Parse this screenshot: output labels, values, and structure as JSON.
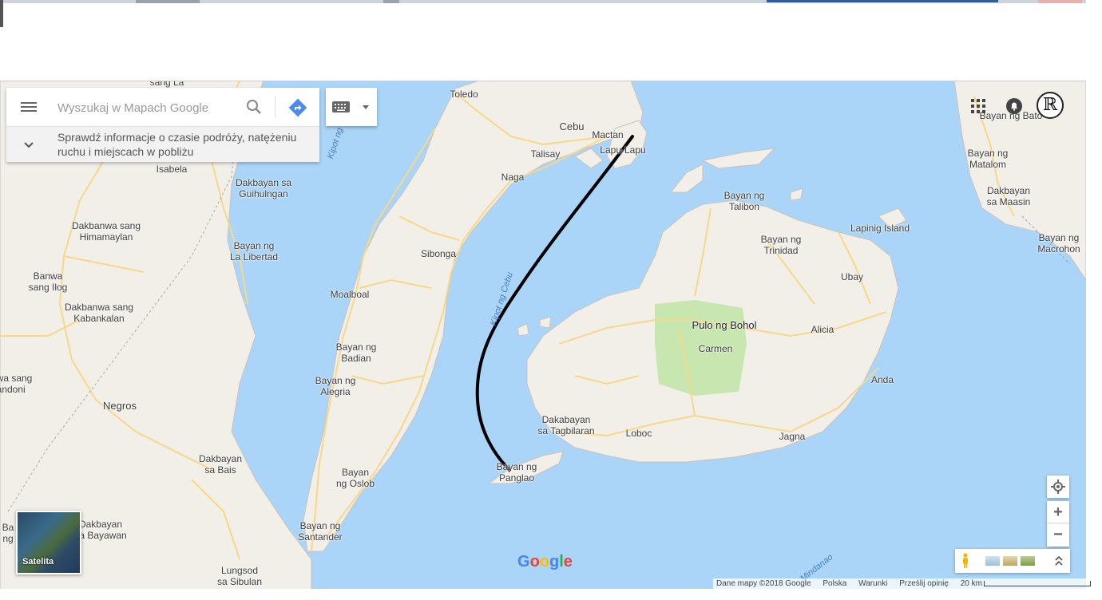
{
  "search": {
    "placeholder": "Wyszukaj w Mapach Google",
    "info_text": "Sprawdź informacje o czasie podróży, natężeniu ruchu i miejscach w pobliżu"
  },
  "places": {
    "toledo": "Toledo",
    "cebu": "Cebu",
    "mactan": "Mactan",
    "lapulapu": "Lapu-Lapu",
    "talisay": "Talisay",
    "naga": "Naga",
    "sibonga": "Sibonga",
    "moalboal": "Moalboal",
    "badian": "Bayan ng\nBadian",
    "alegria": "Bayan ng\nAlegria",
    "oslob": "Bayan\nng Oslob",
    "santander": "Bayan ng\nSantander",
    "isabela": "Isabela",
    "guihulngan": "Dakbayan sa\nGuihulngan",
    "himamaylan": "Dakbanwa sang\nHimamaylan",
    "lalibertad": "Bayan ng\nLa Libertad",
    "ilog": "Banwa\nsang Ilog",
    "kabankalan": "Dakbanwa sang\nKabankalan",
    "negros": "Negros",
    "bais": "Dakbayan\nsa Bais",
    "bayawan": "Dakbayan\nsa Bayawan",
    "sibulan": "Lungsod\nsa Sibulan",
    "candoni": "wa sang\nandoni",
    "sangla": "sang La",
    "talibon": "Bayan ng\nTalibon",
    "trinidad": "Bayan ng\nTrinidad",
    "lapinig": "Lapinig Island",
    "ubay": "Ubay",
    "bohol": "Pulo ng Bohol",
    "carmen": "Carmen",
    "alicia": "Alicia",
    "anda": "Anda",
    "tagbilaran": "Dakabayan\nsa Tagbilaran",
    "loboc": "Loboc",
    "jagna": "Jagna",
    "panglao": "Bayan ng\nPanglao",
    "bato": "Bayan ng Bato",
    "matalom": "Bayan ng\nMatalom",
    "maasin": "Dakbayan\nsa Maasin",
    "macrohon": "Bayan ng\nMacrohon",
    "ba": "Ba\nng"
  },
  "water": {
    "tanon": "Kipot ng Tañon",
    "cebu_strait": "Kipot ng Cebu",
    "mindanao": "Mindanao"
  },
  "satellite_label": "Satelita",
  "logo": "Google",
  "attribution": {
    "data": "Dane mapy ©2018 Google",
    "country": "Polska",
    "terms": "Warunki",
    "feedback": "Prześlij opinię",
    "scale": "20 km"
  },
  "colors": {
    "water": "#abd5f8",
    "land": "#f2efe9",
    "park": "#c8e6b0",
    "road": "#f7d889",
    "route": "#000000",
    "directions_accent": "#4a8af4"
  },
  "icons": {
    "menu": "menu-icon",
    "search": "search-icon",
    "directions": "directions-icon",
    "keyboard": "keyboard-icon",
    "apps": "apps-grid-icon",
    "notifications": "bell-icon",
    "locate": "my-location-icon",
    "pegman": "pegman-icon"
  }
}
